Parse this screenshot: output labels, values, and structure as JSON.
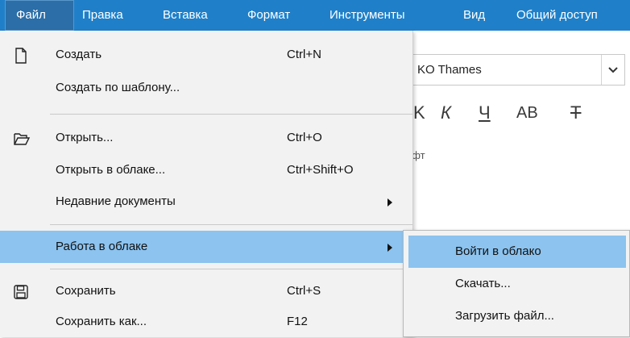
{
  "menubar": {
    "items": [
      "Файл",
      "Правка",
      "Вставка",
      "Формат",
      "Инструменты",
      "Вид",
      "Общий доступ"
    ]
  },
  "toolbar": {
    "font_name": "KO Thames",
    "format_glyphs": [
      "K",
      "К",
      "Ч",
      "АВ",
      "Т"
    ],
    "group_label": "ифт"
  },
  "file_menu": {
    "items": [
      {
        "label": "Создать",
        "shortcut": "Ctrl+N",
        "icon": "new-document-icon"
      },
      {
        "label": "Создать по шаблону...",
        "shortcut": ""
      },
      {
        "label": "Открыть...",
        "shortcut": "Ctrl+O",
        "icon": "folder-open-icon"
      },
      {
        "label": "Открыть в облаке...",
        "shortcut": "Ctrl+Shift+O"
      },
      {
        "label": "Недавние документы",
        "shortcut": ""
      },
      {
        "label": "Работа в облаке",
        "shortcut": ""
      },
      {
        "label": "Сохранить",
        "shortcut": "Ctrl+S",
        "icon": "floppy-disk-icon"
      },
      {
        "label": "Сохранить как...",
        "shortcut": "F12"
      }
    ]
  },
  "cloud_submenu": {
    "items": [
      "Войти в облако",
      "Скачать...",
      "Загрузить файл..."
    ]
  },
  "colors": {
    "menubar_bg": "#1f80c9",
    "highlight": "#8cc3ef",
    "menu_bg": "#f2f2f2"
  }
}
